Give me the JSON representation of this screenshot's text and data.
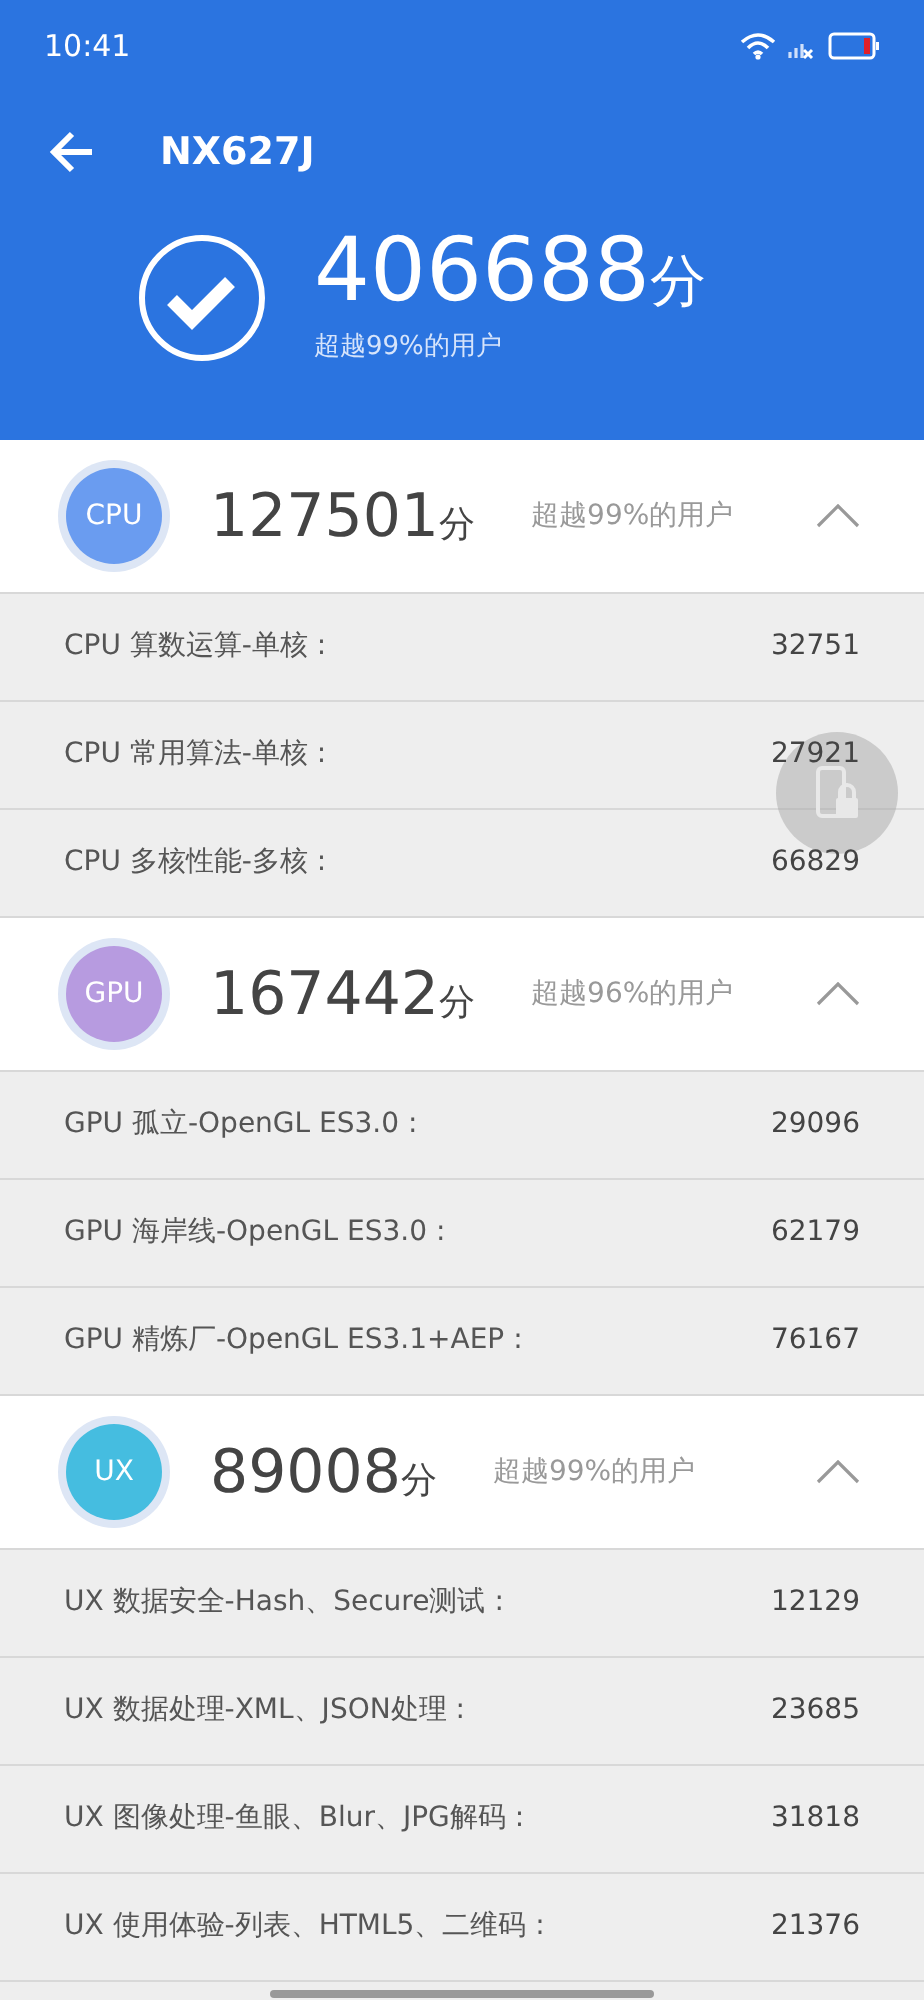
{
  "status_bar": {
    "time": "10:41"
  },
  "header": {
    "title": "NX627J",
    "total_score": "406688",
    "score_unit": "分",
    "rank": "超越99%的用户"
  },
  "sections": [
    {
      "badge": "CPU",
      "color": "#6a9cf0",
      "score": "127501",
      "unit": "分",
      "rank": "超越99%的用户",
      "expanded": true,
      "items": [
        {
          "label": "CPU 算数运算-单核 :",
          "value": "32751"
        },
        {
          "label": "CPU 常用算法-单核 :",
          "value": "27921"
        },
        {
          "label": "CPU 多核性能-多核 :",
          "value": "66829"
        }
      ]
    },
    {
      "badge": "GPU",
      "color": "#b79be0",
      "score": "167442",
      "unit": "分",
      "rank": "超越96%的用户",
      "expanded": true,
      "items": [
        {
          "label": "GPU 孤立-OpenGL ES3.0 :",
          "value": "29096"
        },
        {
          "label": "GPU 海岸线-OpenGL ES3.0 :",
          "value": "62179"
        },
        {
          "label": "GPU 精炼厂-OpenGL ES3.1+AEP :",
          "value": "76167"
        }
      ]
    },
    {
      "badge": "UX",
      "color": "#45bde0",
      "score": "89008",
      "unit": "分",
      "rank": "超越99%的用户",
      "expanded": true,
      "items": [
        {
          "label": "UX 数据安全-Hash、Secure测试 :",
          "value": "12129"
        },
        {
          "label": "UX 数据处理-XML、JSON处理 :",
          "value": "23685"
        },
        {
          "label": "UX 图像处理-鱼眼、Blur、JPG解码 :",
          "value": "31818"
        },
        {
          "label": "UX 使用体验-列表、HTML5、二维码 :",
          "value": "21376"
        }
      ]
    }
  ]
}
